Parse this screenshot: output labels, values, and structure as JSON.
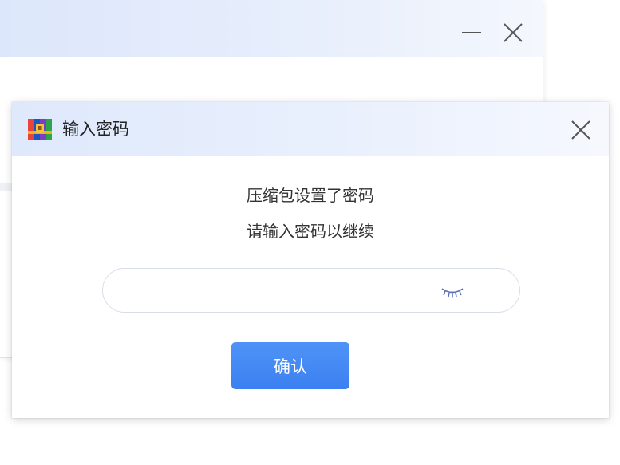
{
  "background_window": {
    "minimize_icon": "minimize-icon",
    "close_icon": "close-icon"
  },
  "dialog": {
    "title": "输入密码",
    "app_icon": "archive-app-icon",
    "close_icon": "close-icon",
    "message_line1": "压缩包设置了密码",
    "message_line2": "请输入密码以继续",
    "password_field": {
      "value": "",
      "placeholder": "",
      "toggle_icon": "eye-closed-icon"
    },
    "confirm_label": "确认"
  },
  "colors": {
    "accent": "#3d83f2",
    "title_gradient_start": "#dfe9fc",
    "title_gradient_end": "#f6f8fe",
    "text": "#333333"
  }
}
